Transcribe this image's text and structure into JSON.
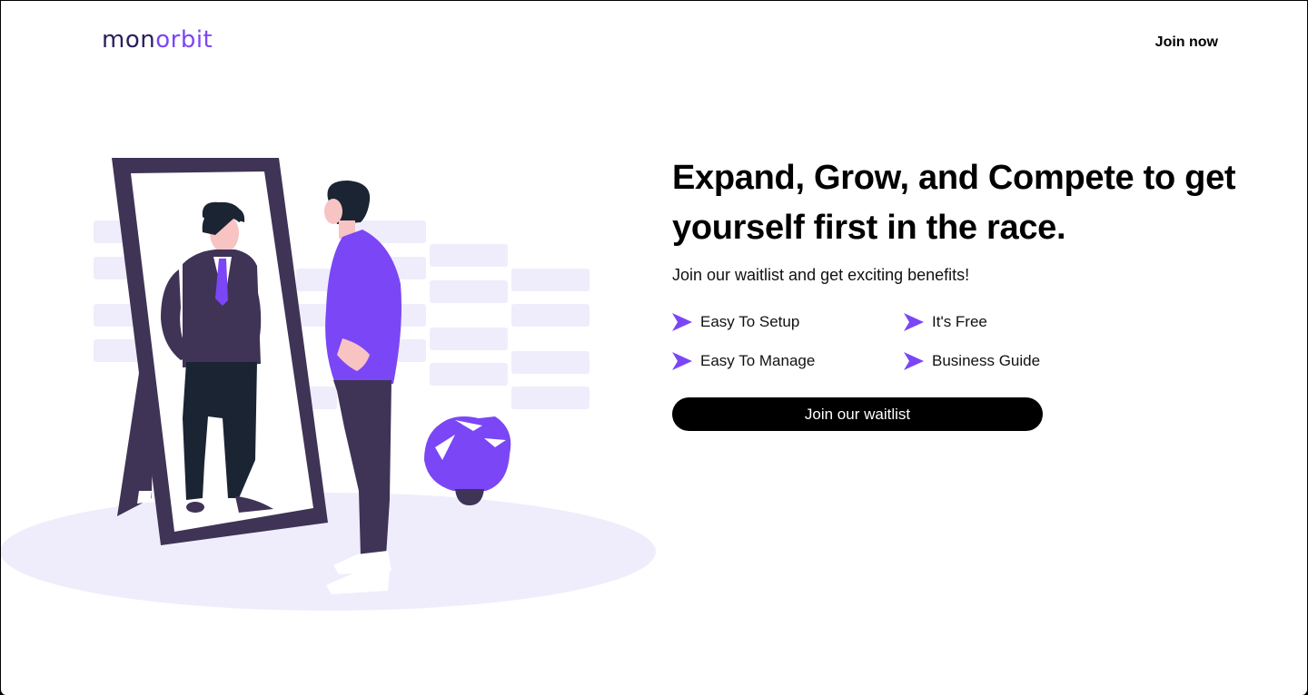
{
  "header": {
    "logo_part1": "mon",
    "logo_part2": "o",
    "logo_part3": "rbit",
    "join_now_label": "Join now"
  },
  "hero": {
    "headline": "Expand, Grow, and Compete to get yourself first in the race.",
    "subline": "Join our waitlist and get exciting benefits!",
    "benefits": [
      "Easy To Setup",
      "It's Free",
      "Easy To Manage",
      "Business Guide"
    ],
    "cta_label": "Join our waitlist"
  },
  "colors": {
    "accent": "#7b46f6",
    "illustration_bg": "#efedfb",
    "dark_suit": "#3f3356"
  },
  "icons": {
    "benefit": "arrow-pointer-icon"
  }
}
